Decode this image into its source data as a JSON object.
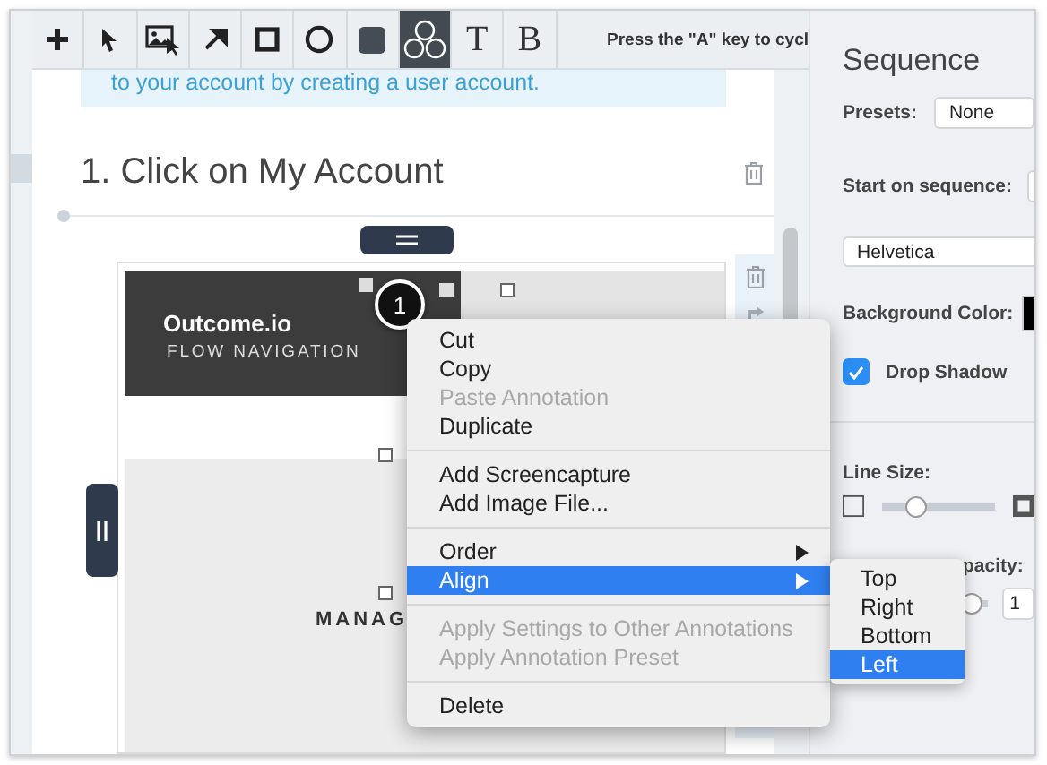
{
  "toolbar": {
    "tools": [
      {
        "kind": "plus",
        "selected": false
      },
      {
        "kind": "pointer",
        "selected": false
      },
      {
        "kind": "image",
        "selected": false
      },
      {
        "kind": "arrow",
        "selected": false
      },
      {
        "kind": "rectangle",
        "selected": false
      },
      {
        "kind": "ellipse",
        "selected": false
      },
      {
        "kind": "filled-rectangle",
        "selected": false
      },
      {
        "kind": "sequence",
        "selected": true
      },
      {
        "kind": "text",
        "label": "T",
        "selected": false
      },
      {
        "kind": "blur",
        "label": "B",
        "selected": false
      }
    ],
    "hint": "Press the \"A\" key to cycl"
  },
  "document": {
    "info_text": "to your account by creating a user account.",
    "step_heading": "1. Click on My Account",
    "screenshot": {
      "brand": "Outcome.io",
      "subtitle": "FLOW NAVIGATION",
      "body_text": "MANAG",
      "badge": "1"
    }
  },
  "context_menu": {
    "groups": [
      [
        {
          "label": "Cut",
          "disabled": false,
          "selected": false,
          "submenu": false
        },
        {
          "label": "Copy",
          "disabled": false,
          "selected": false,
          "submenu": false
        },
        {
          "label": "Paste Annotation",
          "disabled": true,
          "selected": false,
          "submenu": false
        },
        {
          "label": "Duplicate",
          "disabled": false,
          "selected": false,
          "submenu": false
        }
      ],
      [
        {
          "label": "Add Screencapture",
          "disabled": false,
          "selected": false,
          "submenu": false
        },
        {
          "label": "Add Image File...",
          "disabled": false,
          "selected": false,
          "submenu": false
        }
      ],
      [
        {
          "label": "Order",
          "disabled": false,
          "selected": false,
          "submenu": true
        },
        {
          "label": "Align",
          "disabled": false,
          "selected": true,
          "submenu": true
        }
      ],
      [
        {
          "label": "Apply Settings to Other Annotations",
          "disabled": true,
          "selected": false,
          "submenu": false
        },
        {
          "label": "Apply Annotation Preset",
          "disabled": true,
          "selected": false,
          "submenu": false
        }
      ],
      [
        {
          "label": "Delete",
          "disabled": false,
          "selected": false,
          "submenu": false
        }
      ]
    ],
    "submenu": [
      {
        "label": "Top",
        "selected": false
      },
      {
        "label": "Right",
        "selected": false
      },
      {
        "label": "Bottom",
        "selected": false
      },
      {
        "label": "Left",
        "selected": true
      }
    ]
  },
  "panel": {
    "title": "Sequence",
    "presets": {
      "label": "Presets:",
      "value": "None"
    },
    "start_on_sequence": {
      "label": "Start on sequence:"
    },
    "font": {
      "value": "Helvetica"
    },
    "background_color": {
      "label": "Background Color:"
    },
    "drop_shadow": {
      "label": "Drop Shadow",
      "checked": true
    },
    "line_size": {
      "label": "Line Size:",
      "level": 0.3
    },
    "opacity": {
      "label": "pacity:",
      "level": 0.85,
      "value": "1"
    }
  }
}
